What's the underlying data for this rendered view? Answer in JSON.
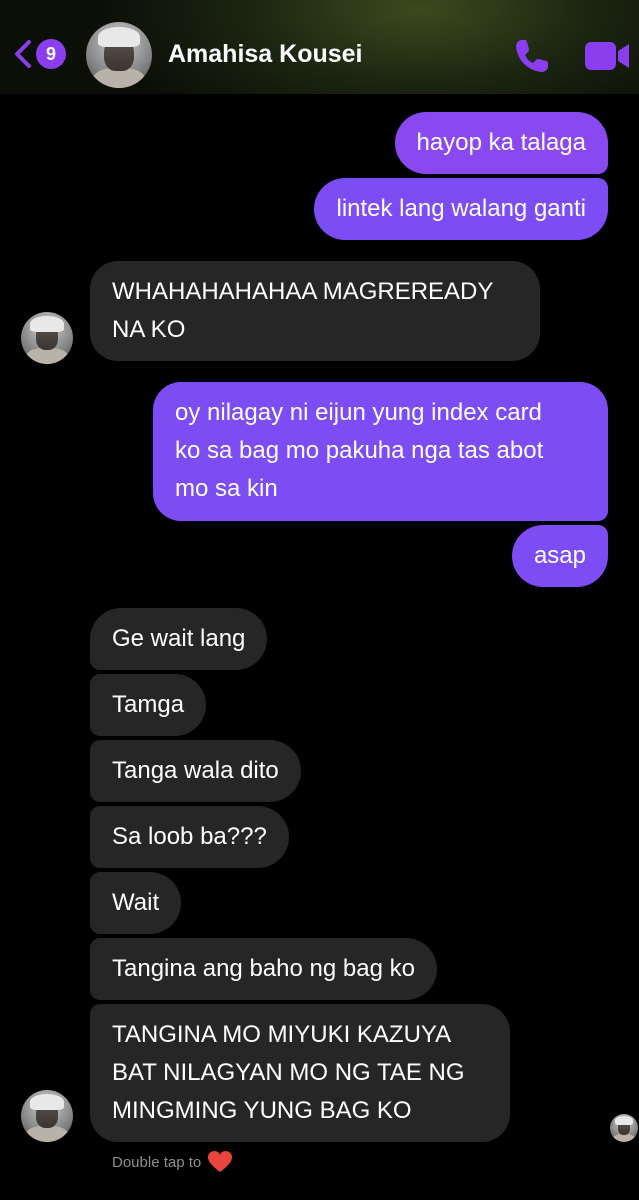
{
  "header": {
    "unread_count": "9",
    "contact_name": "Amahisa Kousei"
  },
  "messages": [
    {
      "from": "me",
      "text": "hayop ka talaga"
    },
    {
      "from": "me",
      "text": "lintek lang walang ganti"
    },
    {
      "from": "them",
      "lines": [
        "WHAHAHAHAHAA MAGREREADY",
        "NA KO"
      ]
    },
    {
      "from": "me",
      "lines": [
        "oy nilagay ni eijun yung index card",
        "ko sa bag mo pakuha nga tas abot",
        "mo sa kin"
      ]
    },
    {
      "from": "me",
      "text": "asap"
    },
    {
      "from": "them",
      "text": "Ge wait lang"
    },
    {
      "from": "them",
      "text": "Tamga"
    },
    {
      "from": "them",
      "text": "Tanga wala dito"
    },
    {
      "from": "them",
      "text": "Sa loob ba???"
    },
    {
      "from": "them",
      "text": "Wait"
    },
    {
      "from": "them",
      "text": "Tangina ang baho ng bag ko"
    },
    {
      "from": "them",
      "lines": [
        "TANGINA MO MIYUKI KAZUYA",
        "BAT NILAGYAN MO NG TAE NG",
        "MINGMING YUNG BAG KO"
      ]
    }
  ],
  "footer": {
    "hint_text": "Double tap to"
  },
  "colors": {
    "sent_bubble": "#7c4cf5",
    "received_bubble": "#262626",
    "accent": "#8a3ef0"
  },
  "icons": {
    "back": "chevron-left-icon",
    "call": "phone-icon",
    "video": "video-camera-icon",
    "reaction": "heart-icon"
  }
}
